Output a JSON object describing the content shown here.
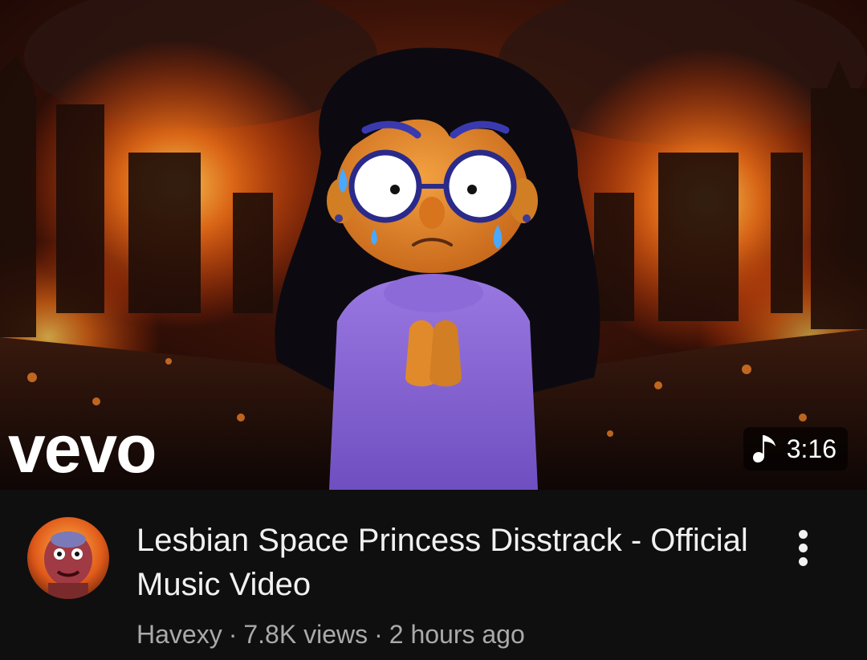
{
  "video": {
    "title": "Lesbian Space Princess Disstrack - Official Music Video",
    "channel": "Havexy",
    "separator": "·",
    "views": "7.8K views",
    "age": "2 hours ago",
    "duration": "3:16",
    "watermark": "vevo"
  },
  "icons": {
    "duration_icon": "music-note-icon",
    "menu_icon": "more-vert-icon",
    "avatar": "channel-avatar"
  },
  "colors": {
    "background": "#0f0f0f",
    "title": "#f1f1f1",
    "subtext": "#aaaaaa",
    "badge_bg": "#000000",
    "fire": "#ff7a1a",
    "sweater": "#8b66d6"
  }
}
